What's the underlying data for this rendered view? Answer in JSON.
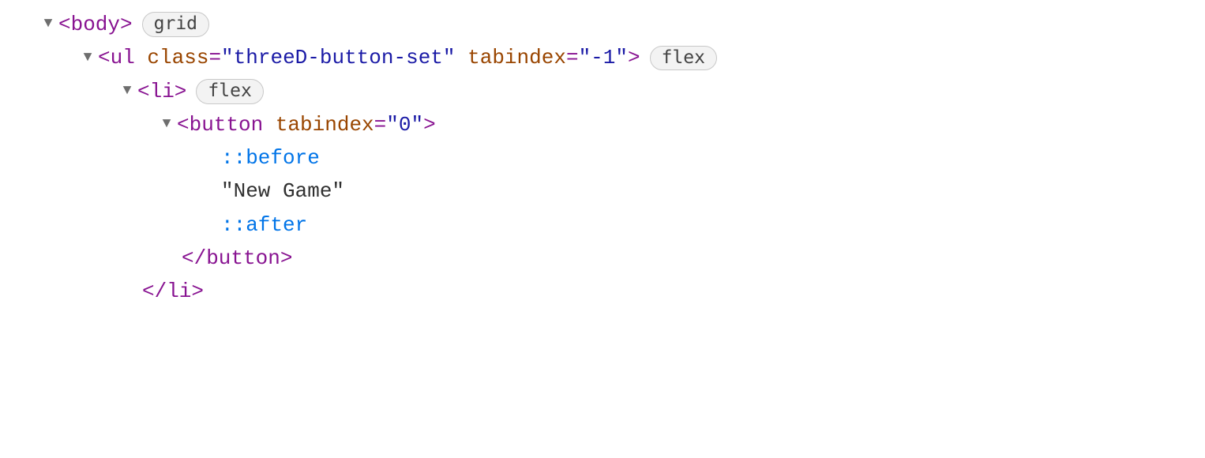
{
  "rows": [
    {
      "indent": 54,
      "arrow": "▼",
      "parts": [
        {
          "t": "tag",
          "v": "<body>"
        }
      ],
      "badge": "grid"
    },
    {
      "indent": 104,
      "arrow": "▼",
      "parts": [
        {
          "t": "tag",
          "v": "<ul "
        },
        {
          "t": "attr-name",
          "v": "class"
        },
        {
          "t": "tag",
          "v": "="
        },
        {
          "t": "quote",
          "v": "\""
        },
        {
          "t": "attr-value",
          "v": "threeD-button-set"
        },
        {
          "t": "quote",
          "v": "\""
        },
        {
          "t": "tag",
          "v": " "
        },
        {
          "t": "attr-name",
          "v": "tabindex"
        },
        {
          "t": "tag",
          "v": "="
        },
        {
          "t": "quote",
          "v": "\""
        },
        {
          "t": "attr-value",
          "v": "-1"
        },
        {
          "t": "quote",
          "v": "\""
        },
        {
          "t": "tag",
          "v": ">"
        }
      ],
      "badge": "flex"
    },
    {
      "indent": 154,
      "arrow": "▼",
      "parts": [
        {
          "t": "tag",
          "v": "<li>"
        }
      ],
      "badge": "flex"
    },
    {
      "indent": 204,
      "arrow": "▼",
      "parts": [
        {
          "t": "tag",
          "v": "<button "
        },
        {
          "t": "attr-name",
          "v": "tabindex"
        },
        {
          "t": "tag",
          "v": "="
        },
        {
          "t": "quote",
          "v": "\""
        },
        {
          "t": "attr-value",
          "v": "0"
        },
        {
          "t": "quote",
          "v": "\""
        },
        {
          "t": "tag",
          "v": ">"
        }
      ]
    },
    {
      "indent": 280,
      "arrow": "",
      "parts": [
        {
          "t": "pseudo",
          "v": "::before"
        }
      ]
    },
    {
      "indent": 280,
      "arrow": "",
      "parts": [
        {
          "t": "textnode",
          "v": "\"New Game\""
        }
      ]
    },
    {
      "indent": 280,
      "arrow": "",
      "parts": [
        {
          "t": "pseudo",
          "v": "::after"
        }
      ]
    },
    {
      "indent": 230,
      "arrow": "",
      "parts": [
        {
          "t": "tag",
          "v": "</button>"
        }
      ]
    },
    {
      "indent": 180,
      "arrow": "",
      "parts": [
        {
          "t": "tag",
          "v": "</li>"
        }
      ]
    }
  ]
}
